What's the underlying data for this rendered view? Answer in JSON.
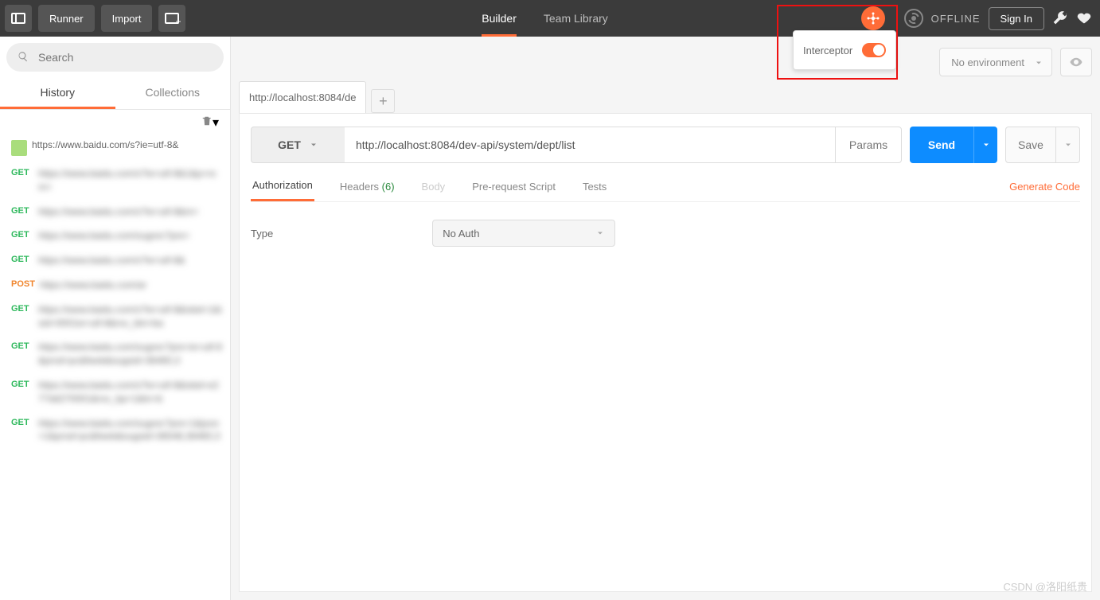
{
  "topbar": {
    "runner": "Runner",
    "import": "Import",
    "builder": "Builder",
    "team_library": "Team Library",
    "offline": "OFFLINE",
    "signin": "Sign In"
  },
  "interceptor": {
    "label": "Interceptor"
  },
  "sidebar": {
    "search_placeholder": "Search",
    "tab_history": "History",
    "tab_collections": "Collections",
    "items": [
      {
        "method": "",
        "url": "https://www.baidu.com/s?ie=utf-8&"
      },
      {
        "method": "GET",
        "url": "https://www.baidu.com/s?ie=utf-8&1&p=rom="
      },
      {
        "method": "GET",
        "url": "https://www.baidu.com/s?ie=utf-8&m="
      },
      {
        "method": "GET",
        "url": "https://www.baidu.com/sugrec?pre="
      },
      {
        "method": "GET",
        "url": "https://www.baidu.com/s?ie=utf-8&"
      },
      {
        "method": "POST",
        "url": "https://www.baidu.com/ar"
      },
      {
        "method": "GET",
        "url": "https://www.baidu.com/s?ie=utf-8&isbd=1&isid=0001ie=utf-8&rsv_btn=ba"
      },
      {
        "method": "GET",
        "url": "https://www.baidu.com/sugrec?pre=ie=utf-8&prod=pc&fweb&sugsid=36460,3"
      },
      {
        "method": "GET",
        "url": "https://www.baidu.com/s?ie=utf-8&isbd=e277dd270001&rsv_bp=1&tn=b"
      },
      {
        "method": "GET",
        "url": "https://www.baidu.com/sugrec?pre=1&json=1&prod=pc&fweb&sugsid=36548,36460,3"
      }
    ]
  },
  "env": {
    "no_env": "No environment"
  },
  "request": {
    "tab_label": "http://localhost:8084/de",
    "method": "GET",
    "url": "http://localhost:8084/dev-api/system/dept/list",
    "params": "Params",
    "send": "Send",
    "save": "Save"
  },
  "subtabs": {
    "authorization": "Authorization",
    "headers": "Headers",
    "headers_count": "(6)",
    "body": "Body",
    "prerequest": "Pre-request Script",
    "tests": "Tests",
    "generate_code": "Generate Code"
  },
  "auth": {
    "type_label": "Type",
    "value": "No Auth"
  },
  "watermark": "CSDN @洛阳纸贵"
}
